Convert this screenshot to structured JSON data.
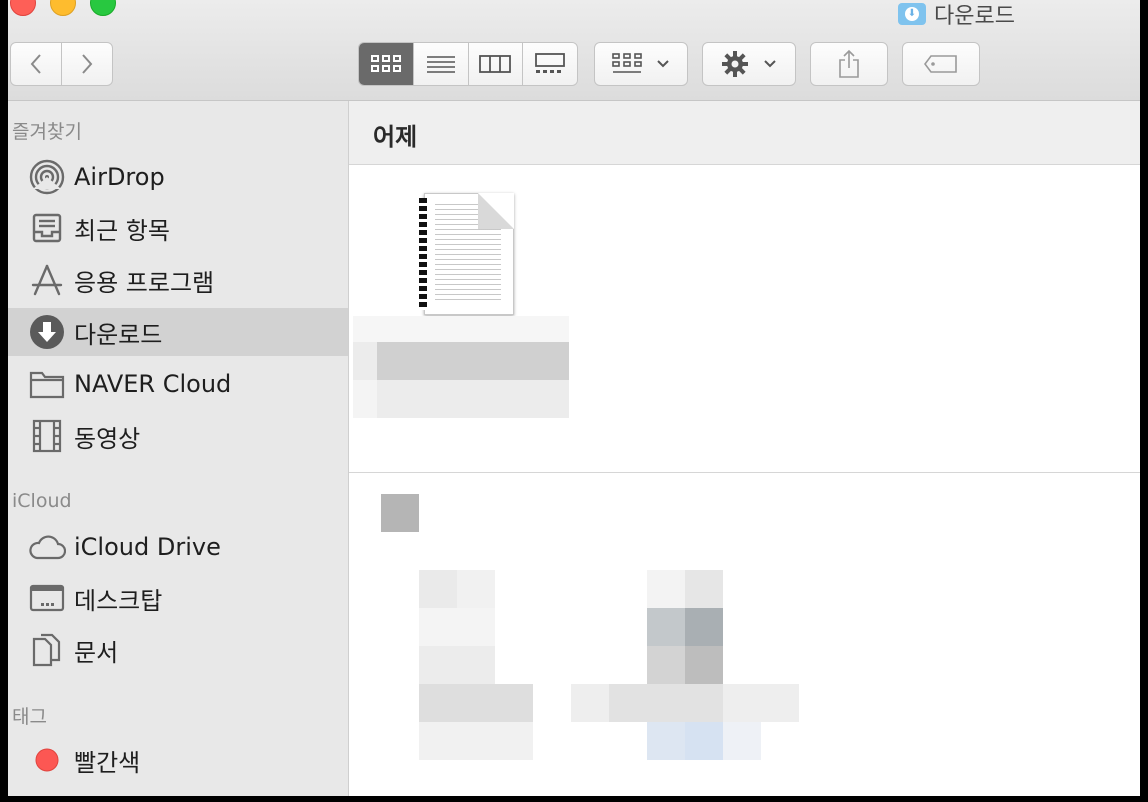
{
  "window": {
    "title": "다운로드",
    "buttons": {
      "close_color": "#fe5f57",
      "minimize_color": "#febc2e",
      "zoom_color": "#28c840"
    }
  },
  "toolbar": {
    "back_icon": "chevron-left-icon",
    "forward_icon": "chevron-right-icon",
    "view_modes": [
      "icon-view",
      "list-view",
      "column-view",
      "gallery-view"
    ],
    "selected_view": "icon-view",
    "group_icon": "group-by-icon",
    "action_icon": "gear-icon",
    "share_icon": "share-icon",
    "tag_icon": "tag-icon"
  },
  "sidebar": {
    "favorites_header": "즐겨찾기",
    "favorites": [
      {
        "label": "AirDrop",
        "icon": "airdrop-icon"
      },
      {
        "label": "최근 항목",
        "icon": "recents-icon"
      },
      {
        "label": "응용 프로그램",
        "icon": "applications-icon"
      },
      {
        "label": "다운로드",
        "icon": "downloads-icon",
        "selected": true
      },
      {
        "label": "NAVER Cloud",
        "icon": "folder-icon"
      },
      {
        "label": "동영상",
        "icon": "movies-icon"
      }
    ],
    "icloud_header": "iCloud",
    "icloud": [
      {
        "label": "iCloud Drive",
        "icon": "cloud-icon"
      },
      {
        "label": "데스크탑",
        "icon": "desktop-icon"
      },
      {
        "label": "문서",
        "icon": "document-icon"
      }
    ],
    "tags_header": "태그",
    "tags": [
      {
        "label": "빨간색",
        "color": "#fc5753"
      }
    ]
  },
  "main": {
    "section_title": "어제"
  }
}
